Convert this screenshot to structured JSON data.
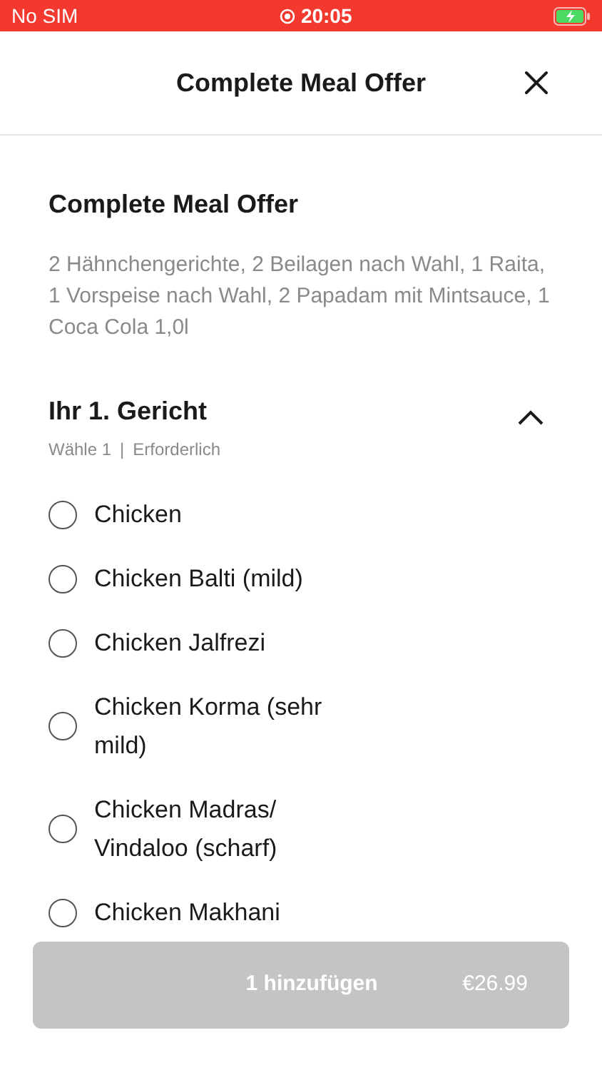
{
  "status_bar": {
    "carrier": "No SIM",
    "time": "20:05"
  },
  "header": {
    "title": "Complete Meal Offer"
  },
  "offer": {
    "title": "Complete Meal Offer",
    "description": "2 Hähnchengerichte, 2 Beilagen nach Wahl, 1 Raita, 1 Vorspeise nach Wahl, 2 Papadam mit Mintsauce, 1 Coca Cola 1,0l"
  },
  "section": {
    "title": "Ihr 1. Gericht",
    "rule": "Wähle 1",
    "requirement": "Erforderlich",
    "separator": "|",
    "expanded": true,
    "options": [
      {
        "label": "Chicken",
        "selected": false
      },
      {
        "label": "Chicken Balti (mild)",
        "selected": false
      },
      {
        "label": "Chicken Jalfrezi",
        "selected": false
      },
      {
        "label": "Chicken Korma (sehr mild)",
        "selected": false
      },
      {
        "label": "Chicken Madras/ Vindaloo (scharf)",
        "selected": false
      },
      {
        "label": "Chicken Makhani",
        "selected": false
      }
    ]
  },
  "add_button": {
    "label": "1 hinzufügen",
    "price": "€26.99",
    "disabled": true
  }
}
